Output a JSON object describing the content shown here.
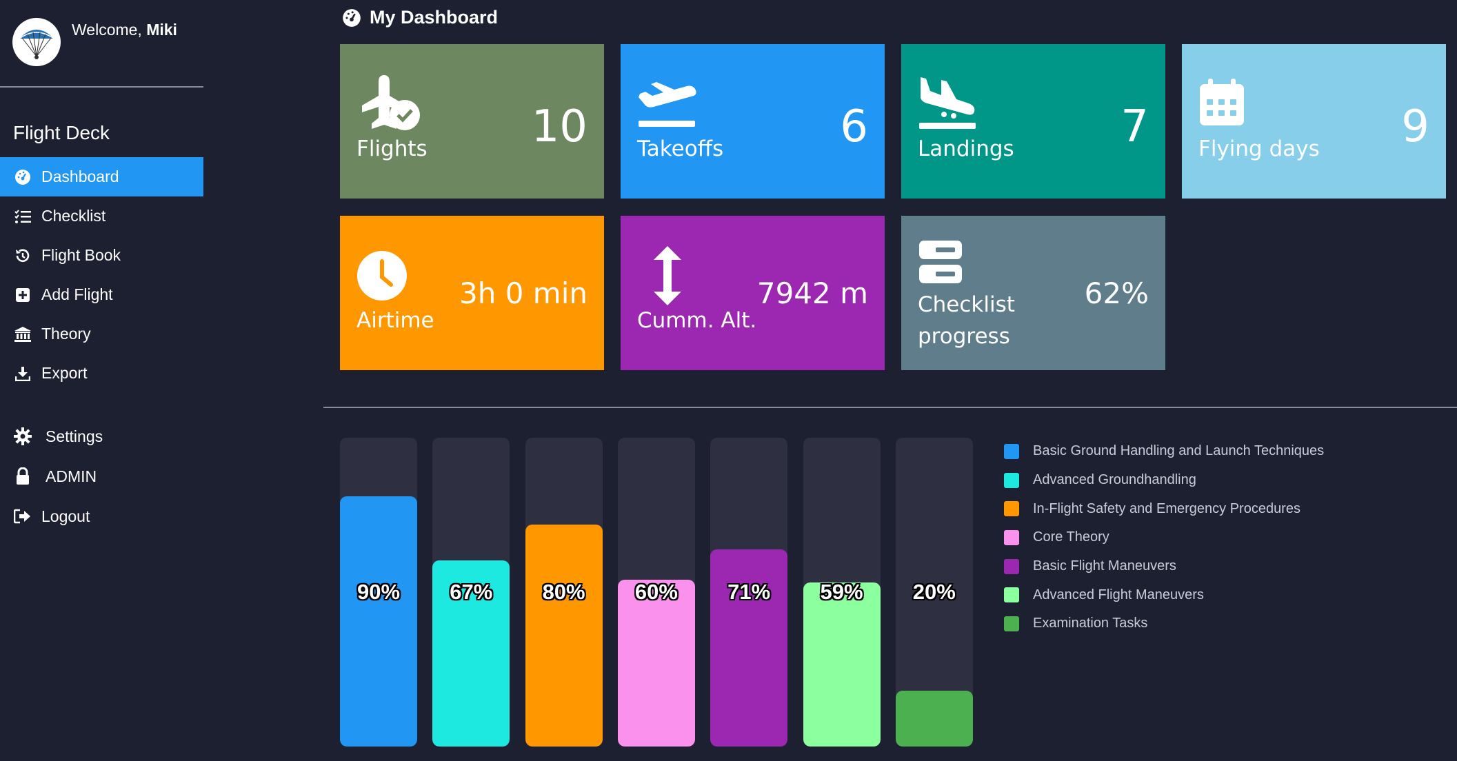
{
  "sidebar": {
    "welcome_prefix": "Welcome, ",
    "user_name": "Miki",
    "brand": "Flight Deck",
    "items": [
      {
        "label": "Dashboard",
        "icon": "gauge-icon",
        "active": true
      },
      {
        "label": "Checklist",
        "icon": "list-check-icon"
      },
      {
        "label": "Flight Book",
        "icon": "history-icon"
      },
      {
        "label": "Add Flight",
        "icon": "plus-square-icon"
      },
      {
        "label": "Theory",
        "icon": "bank-icon"
      },
      {
        "label": "Export",
        "icon": "download-icon"
      }
    ],
    "secondary": [
      {
        "label": "Settings",
        "icon": "gear-icon"
      },
      {
        "label": "ADMIN",
        "icon": "lock-icon"
      },
      {
        "label": "Logout",
        "icon": "logout-icon"
      }
    ]
  },
  "page": {
    "title": "My Dashboard"
  },
  "tiles": [
    {
      "label": "Flights",
      "value": "10",
      "color": "#6d8861",
      "icon": "plane-check-icon"
    },
    {
      "label": "Takeoffs",
      "value": "6",
      "color": "#2196f3",
      "icon": "plane-departure-icon"
    },
    {
      "label": "Landings",
      "value": "7",
      "color": "#009688",
      "icon": "plane-arrival-icon"
    },
    {
      "label": "Flying days",
      "value": "9",
      "color": "#87ceeb",
      "icon": "calendar-icon"
    },
    {
      "label": "Airtime",
      "value": "3h 0 min",
      "color": "#ff9800",
      "icon": "clock-icon"
    },
    {
      "label": "Cumm. Alt.",
      "value": "7942 m",
      "color": "#9c27b0",
      "icon": "vertical-arrows-icon"
    },
    {
      "label_line1": "Checklist",
      "label_line2": "progress",
      "value": "62%",
      "color": "#607d8b",
      "icon": "server-icon"
    }
  ],
  "chart_data": {
    "type": "bar",
    "categories": [
      "Basic Ground Handling and Launch Techniques",
      "Advanced Groundhandling",
      "In-Flight Safety and Emergency Procedures",
      "Core Theory",
      "Basic Flight Maneuvers",
      "Advanced Flight Maneuvers",
      "Examination Tasks"
    ],
    "values": [
      90,
      67,
      80,
      60,
      71,
      59,
      20
    ],
    "labels": [
      "90%",
      "67%",
      "80%",
      "60%",
      "71%",
      "59%",
      "20%"
    ],
    "colors": [
      "#2196f3",
      "#1de9e0",
      "#ff9800",
      "#f991ed",
      "#9c27b0",
      "#8cff9f",
      "#4caf50"
    ],
    "ylim": [
      0,
      100
    ],
    "legend": "right"
  }
}
